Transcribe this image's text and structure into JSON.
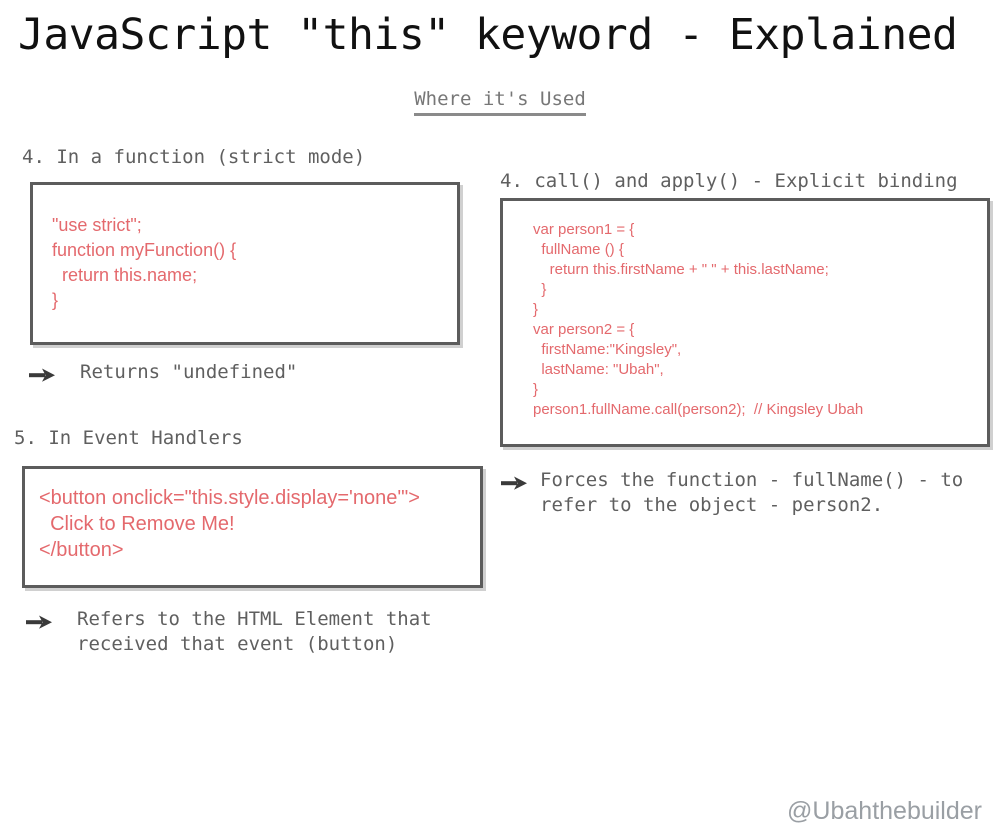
{
  "slide": {
    "title": "JavaScript \"this\" keyword - Explained",
    "subtitle": "Where it's Used",
    "watermark": "@Ubahthebuilder",
    "colors": {
      "title_text": "#111111",
      "heading_text": "#5f5f5f",
      "code_text": "#e4696d",
      "box_border": "#5c5c5c",
      "watermark_text": "#9a9fa4"
    }
  },
  "left_column": {
    "section_strict": {
      "heading": "4. In a function (strict mode)",
      "code": "\"use strict\";\nfunction myFunction() {\n  return this.name;\n}",
      "note": "Returns \"undefined\"",
      "arrow_icon": "arrow-right-icon"
    },
    "section_events": {
      "heading": "5. In Event Handlers",
      "code": "<button onclick=\"this.style.display='none'\">\n  Click to Remove Me!\n</button>",
      "note": "Refers to the HTML Element that\nreceived that event (button)",
      "arrow_icon": "arrow-right-icon"
    }
  },
  "right_column": {
    "section_call_apply": {
      "heading": "4. call() and apply() - Explicit binding",
      "code": "var person1 = {\n  fullName () {\n    return this.firstName + \" \" + this.lastName;\n  }\n}\nvar person2 = {\n  firstName:\"Kingsley\",\n  lastName: \"Ubah\",\n}\nperson1.fullName.call(person2);  // Kingsley Ubah",
      "note": "Forces the function - fullName() - to\nrefer to the object - person2.",
      "arrow_icon": "arrow-right-icon"
    }
  }
}
